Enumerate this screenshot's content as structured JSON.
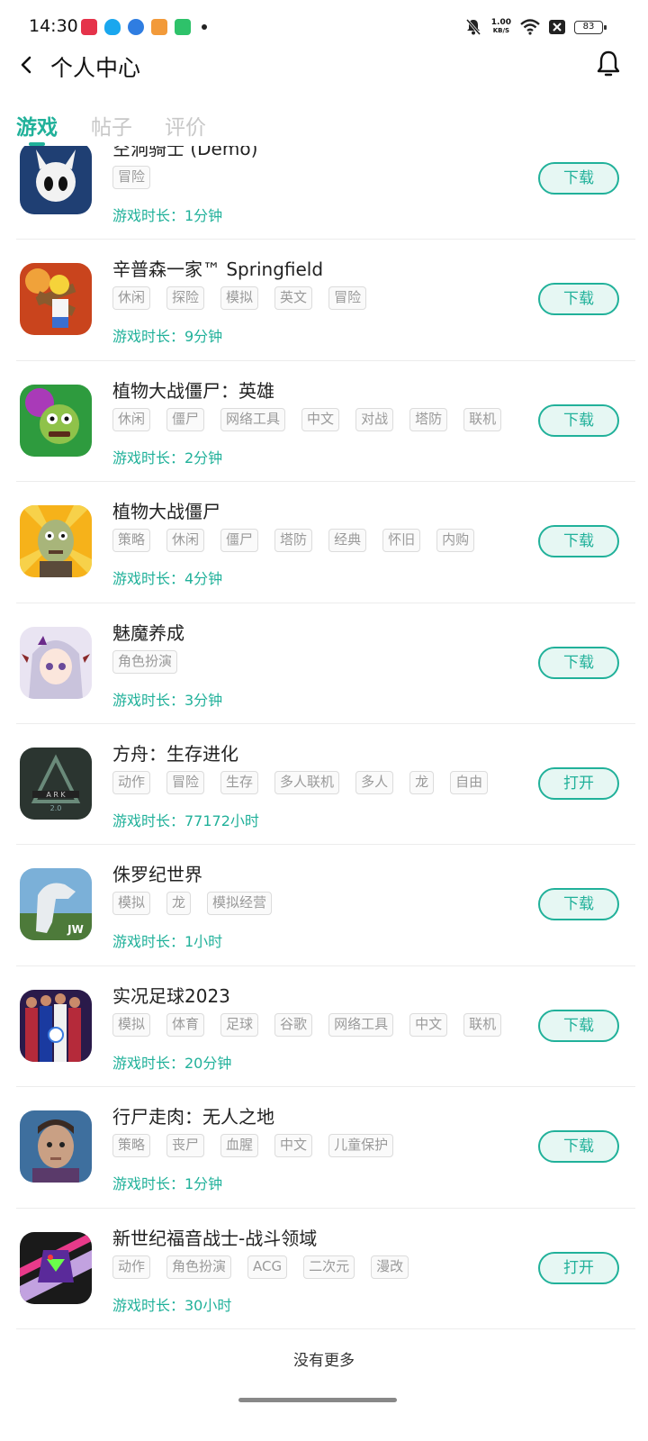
{
  "status_bar": {
    "time": "14:30",
    "net_speed_value": "1.00",
    "net_speed_unit": "KB/S",
    "battery": "83",
    "notification_icons": [
      "video-app-icon",
      "qq-icon",
      "app-circle-icon",
      "game-app-icon",
      "wechat-app-icon"
    ],
    "system_icons": [
      "mute-bell-icon",
      "wifi-icon",
      "close-box-icon",
      "battery-icon"
    ]
  },
  "header": {
    "title": "个人中心"
  },
  "tabs": [
    {
      "label": "游戏",
      "active": true
    },
    {
      "label": "帖子",
      "active": false
    },
    {
      "label": "评价",
      "active": false
    }
  ],
  "colors": {
    "accent": "#21b19a",
    "button_bg": "#e6f7f3",
    "tag_border": "#dcdcdc",
    "tag_text": "#9a9a9a"
  },
  "games": [
    {
      "name": "空洞骑士 (Demo)",
      "tags": [
        "冒险"
      ],
      "playtime": "游戏时长：1分钟",
      "action": "下载",
      "icon": "hollow-knight-icon"
    },
    {
      "name": "辛普森一家™ Springfield",
      "tags": [
        "休闲",
        "探险",
        "模拟",
        "英文",
        "冒险"
      ],
      "playtime": "游戏时长：9分钟",
      "action": "下载",
      "icon": "simpsons-icon"
    },
    {
      "name": "植物大战僵尸：英雄",
      "tags": [
        "休闲",
        "僵尸",
        "网络工具",
        "中文",
        "对战",
        "塔防",
        "联机"
      ],
      "playtime": "游戏时长：2分钟",
      "action": "下载",
      "icon": "pvz-heroes-icon"
    },
    {
      "name": "植物大战僵尸",
      "tags": [
        "策略",
        "休闲",
        "僵尸",
        "塔防",
        "经典",
        "怀旧",
        "内购"
      ],
      "playtime": "游戏时长：4分钟",
      "action": "下载",
      "icon": "pvz-zombie-icon"
    },
    {
      "name": "魅魔养成",
      "tags": [
        "角色扮演"
      ],
      "playtime": "游戏时长：3分钟",
      "action": "下载",
      "icon": "anime-girl-icon"
    },
    {
      "name": "方舟：生存进化",
      "tags": [
        "动作",
        "冒险",
        "生存",
        "多人联机",
        "多人",
        "龙",
        "自由"
      ],
      "playtime": "游戏时长：77172小时",
      "action": "打开",
      "icon": "ark-icon"
    },
    {
      "name": "侏罗纪世界",
      "tags": [
        "模拟",
        "龙",
        "模拟经营"
      ],
      "playtime": "游戏时长：1小时",
      "action": "下载",
      "icon": "jurassic-world-icon"
    },
    {
      "name": "实况足球2023",
      "tags": [
        "模拟",
        "体育",
        "足球",
        "谷歌",
        "网络工具",
        "中文",
        "联机"
      ],
      "playtime": "游戏时长：20分钟",
      "action": "下载",
      "icon": "efootball-icon"
    },
    {
      "name": "行尸走肉：无人之地",
      "tags": [
        "策略",
        "丧尸",
        "血腥",
        "中文",
        "儿童保护"
      ],
      "playtime": "游戏时长：1分钟",
      "action": "下载",
      "icon": "walking-dead-icon"
    },
    {
      "name": "新世纪福音战士-战斗领域",
      "tags": [
        "动作",
        "角色扮演",
        "ACG",
        "二次元",
        "漫改"
      ],
      "playtime": "游戏时长：30小时",
      "action": "打开",
      "icon": "evangelion-icon"
    }
  ],
  "footer": {
    "no_more": "没有更多"
  }
}
